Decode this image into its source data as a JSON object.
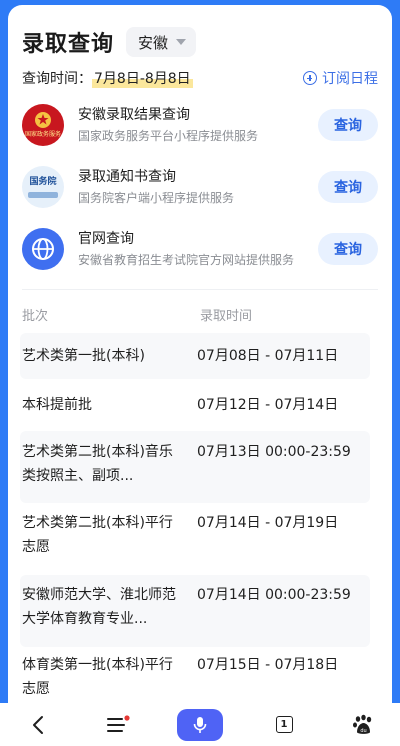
{
  "header": {
    "title": "录取查询",
    "region": "安徽"
  },
  "query_time": {
    "label": "查询时间：",
    "range": "7月8日-8月8日",
    "subscribe_label": "订阅日程"
  },
  "services": [
    {
      "name": "安徽录取结果查询",
      "desc": "国家政务服务平台小程序提供服务",
      "button": "查询",
      "logo_text": "国家政务服务"
    },
    {
      "name": "录取通知书查询",
      "desc": "国务院客户端小程序提供服务",
      "button": "查询",
      "logo_text": "国务院"
    },
    {
      "name": "官网查询",
      "desc": "安徽省教育招生考试院官方网站提供服务",
      "button": "查询",
      "logo_text": ""
    }
  ],
  "table": {
    "headers": {
      "batch": "批次",
      "time": "录取时间"
    },
    "rows": [
      {
        "batch": "艺术类第一批(本科)",
        "time": "07月08日 - 07月11日"
      },
      {
        "batch": "本科提前批",
        "time": "07月12日 - 07月14日"
      },
      {
        "batch": "艺术类第二批(本科)音乐类按照主、副项...",
        "time": "07月13日 00:00-23:59"
      },
      {
        "batch": "艺术类第二批(本科)平行志愿",
        "time": "07月14日 - 07月19日"
      },
      {
        "batch": "安徽师范大学、淮北师范大学体育教育专业...",
        "time": "07月14日 00:00-23:59"
      },
      {
        "batch": "体育类第一批(本科)平行志愿",
        "time": "07月15日 - 07月18日"
      }
    ]
  },
  "navbar": {
    "tab_count": "1",
    "icons": [
      "back-icon",
      "menu-icon",
      "microphone-icon",
      "tabs-icon",
      "baidu-paw-icon"
    ]
  },
  "colors": {
    "accent": "#2a64e0",
    "background": "#2e7bf6",
    "mic": "#4f63f5",
    "highlight": "#fbe79c",
    "badge": "#e53935"
  }
}
